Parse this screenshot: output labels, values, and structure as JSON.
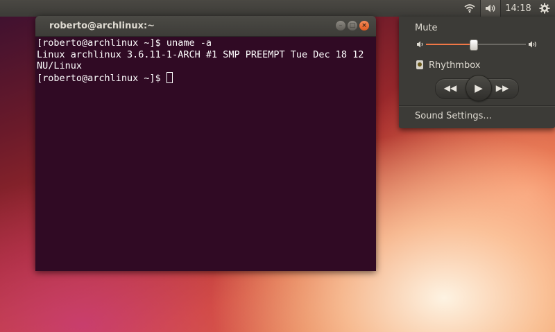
{
  "panel": {
    "clock": "14:18",
    "icons": [
      "wifi-icon",
      "speaker-icon",
      "gear-icon"
    ]
  },
  "terminal": {
    "title": "roberto@archlinux:~",
    "lines": [
      "[roberto@archlinux ~]$ uname -a",
      "Linux archlinux 3.6.11-1-ARCH #1 SMP PREEMPT Tue Dec 18 12",
      "NU/Linux",
      "[roberto@archlinux ~]$ "
    ],
    "colors": {
      "background": "#300a24",
      "foreground": "#ffffff"
    }
  },
  "sound_menu": {
    "mute_label": "Mute",
    "volume_fraction": 0.47,
    "player_name": "Rhythmbox",
    "settings_label": "Sound Settings...",
    "accent": "#f07746"
  }
}
